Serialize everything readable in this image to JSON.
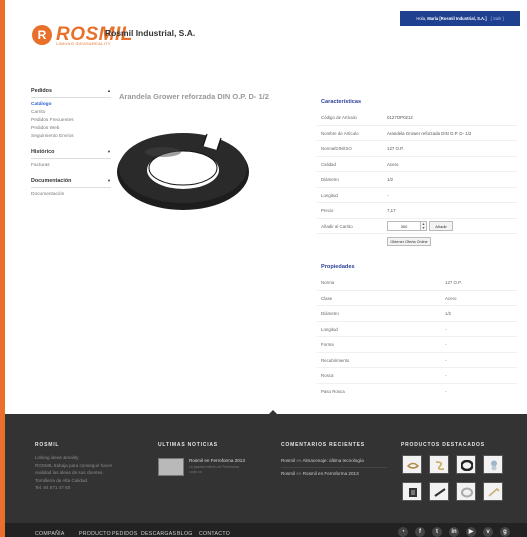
{
  "header": {
    "logo_word": "ROSMIL",
    "logo_tagline": "LINKING IDEAS&REALITY",
    "company_name": "Rosmil Industrial, S.A.",
    "user_greeting": "Hola, ",
    "user_name": "María [Rosmil Industrial, S.A.]",
    "exit_label": "[ Salir ]"
  },
  "sidebar": {
    "groups": [
      {
        "title": "Pedidos",
        "items": [
          "Catálogo",
          "Carrito",
          "Pedidos Frecuentes",
          "Pedidos Web",
          "Seguimiento Envíos"
        ]
      },
      {
        "title": "Histórico",
        "items": [
          "Facturas"
        ]
      },
      {
        "title": "Documentación",
        "items": [
          "Documentación"
        ]
      }
    ]
  },
  "product": {
    "title": "Arandela Grower reforzada DIN O.P. D- 1/2"
  },
  "characteristics": {
    "title": "Características",
    "rows": [
      {
        "k": "Código de Artículo",
        "v": "0127OP0212"
      },
      {
        "k": "Nombre de Artículo",
        "v": "Arandela Grower reforzada DIN O.P. D- 1/2"
      },
      {
        "k": "Norma/DIN/ISO",
        "v": "127 O.P."
      },
      {
        "k": "Calidad",
        "v": "Acero"
      },
      {
        "k": "Diámetro",
        "v": "1/2"
      },
      {
        "k": "Longitud",
        "v": "-"
      },
      {
        "k": "Precio",
        "v": "7,17"
      }
    ],
    "cart_label": "Añadir al Carrito",
    "quantity": "300",
    "add_label": "Añadir",
    "offer_label": "Obtener Oferta Online"
  },
  "properties": {
    "title": "Propiedades",
    "rows": [
      {
        "k": "Norma",
        "v": "127 O.P."
      },
      {
        "k": "Clase",
        "v": "Acero"
      },
      {
        "k": "Diámetro",
        "v": "1/2"
      },
      {
        "k": "Longitud",
        "v": "-"
      },
      {
        "k": "Forma",
        "v": "-"
      },
      {
        "k": "Recubrimiento",
        "v": "-"
      },
      {
        "k": "Rosca",
        "v": "-"
      },
      {
        "k": "Paso Rosca",
        "v": "-"
      }
    ]
  },
  "footer": {
    "col1_title": "ROSMIL",
    "col1_lines": [
      "Linking ideas &reality",
      "ROSMIL trabaja para conseguir hacer",
      "realidad las ideas de sus clientes.",
      "Tornillería de Alta Calidad",
      "Tel. 94 671 47 60"
    ],
    "col2_title": "ULTIMAS NOTICIAS",
    "news_title": "Rosmil en Ferroforma 2013",
    "news_sub": "La pasada edición de Ferroforma conto co",
    "col3_title": "COMENTARIOS RECIENTES",
    "comments": [
      {
        "author": "Rosmil",
        "en": " en ",
        "post": "Almacenaje: última tecnología"
      },
      {
        "author": "Rosmil",
        "en": " en ",
        "post": "Rosmil en Ferroforma 2013"
      }
    ],
    "col4_title": "PRODUCTOS DESTACADOS",
    "nav": [
      "COMPAÑÍA",
      "PRODUCTO",
      "PEDIDOS",
      "DESCARGAS",
      "BLOG",
      "CONTACTO"
    ]
  },
  "colors": {
    "accent": "#e8702a",
    "brand_blue": "#1f3f8f",
    "link_blue": "#2b63c6",
    "footer_bg": "#333333"
  }
}
